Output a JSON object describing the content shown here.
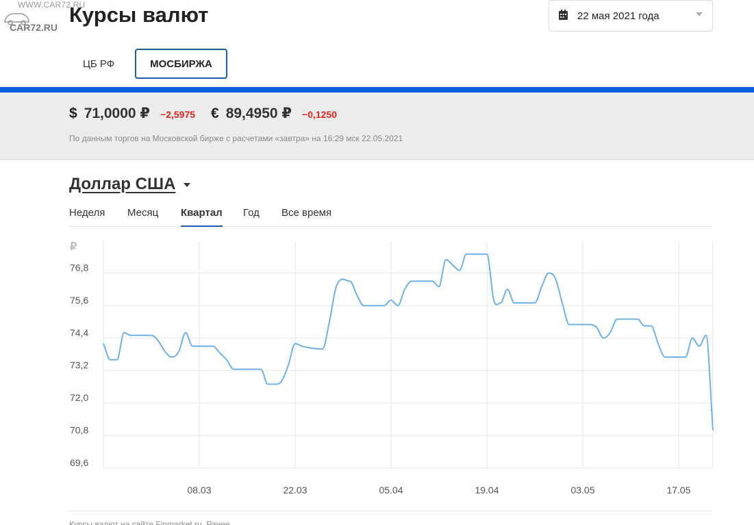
{
  "watermark": {
    "line1": "WWW.CAR72.RU",
    "line2": "CAR72.RU"
  },
  "header": {
    "title": "Курсы валют",
    "date_value": "22 мая 2021 года",
    "date_icon": "calendar-icon"
  },
  "source_tabs": [
    {
      "label": "ЦБ РФ",
      "active": false
    },
    {
      "label": "МОСБИРЖА",
      "active": true
    }
  ],
  "colors": {
    "accent_bar": "#0a5fe0",
    "negative_change": "#e0241b",
    "line": "#6fb1e6",
    "active_border": "#1a5aa8"
  },
  "rates": {
    "usd": {
      "symbol": "$",
      "value": "71,0000 ₽",
      "change": "−2,5975"
    },
    "eur": {
      "symbol": "€",
      "value": "89,4950 ₽",
      "change": "−0,1250"
    },
    "note": "По данным торгов на Московской бирже с расчетами «завтра» на 16:29 мск 22.05.2021"
  },
  "currency": {
    "name": "Доллар США"
  },
  "period_tabs": [
    {
      "label": "Неделя",
      "active": false
    },
    {
      "label": "Месяц",
      "active": false
    },
    {
      "label": "Квартал",
      "active": true
    },
    {
      "label": "Год",
      "active": false
    },
    {
      "label": "Все время",
      "active": false
    }
  ],
  "chart_data": {
    "type": "line",
    "ylabel": "₽",
    "ylim": [
      69.6,
      78.0
    ],
    "yticks": [
      "76,8",
      "75,6",
      "74,4",
      "73,2",
      "72,0",
      "70,8",
      "69,6"
    ],
    "ytick_values": [
      76.8,
      75.6,
      74.4,
      73.2,
      72.0,
      70.8,
      69.6
    ],
    "xlim": [
      "2021-02-22",
      "2021-05-22"
    ],
    "xticks": [
      {
        "label": "08.03",
        "date": "2021-03-08"
      },
      {
        "label": "22.03",
        "date": "2021-03-22"
      },
      {
        "label": "05.04",
        "date": "2021-04-05"
      },
      {
        "label": "19.04",
        "date": "2021-04-19"
      },
      {
        "label": "03.05",
        "date": "2021-05-03"
      },
      {
        "label": "17.05",
        "date": "2021-05-17"
      }
    ],
    "grid": true,
    "series": [
      {
        "points": [
          [
            "2021-02-22",
            74.2
          ],
          [
            "2021-02-23",
            73.6
          ],
          [
            "2021-02-24",
            73.6
          ],
          [
            "2021-02-25",
            74.6
          ],
          [
            "2021-02-26",
            74.5
          ],
          [
            "2021-03-01",
            74.5
          ],
          [
            "2021-03-02",
            74.3
          ],
          [
            "2021-03-03",
            73.9
          ],
          [
            "2021-03-04",
            73.7
          ],
          [
            "2021-03-05",
            73.9
          ],
          [
            "2021-03-06",
            74.6
          ],
          [
            "2021-03-07",
            74.1
          ],
          [
            "2021-03-10",
            74.1
          ],
          [
            "2021-03-11",
            73.85
          ],
          [
            "2021-03-12",
            73.6
          ],
          [
            "2021-03-13",
            73.25
          ],
          [
            "2021-03-14",
            73.25
          ],
          [
            "2021-03-17",
            73.25
          ],
          [
            "2021-03-18",
            72.7
          ],
          [
            "2021-03-19",
            72.7
          ],
          [
            "2021-03-20",
            72.8
          ],
          [
            "2021-03-21",
            73.4
          ],
          [
            "2021-03-22",
            74.2
          ],
          [
            "2021-03-23",
            74.1
          ],
          [
            "2021-03-26",
            74.0
          ],
          [
            "2021-03-27",
            75.0
          ],
          [
            "2021-03-28",
            76.3
          ],
          [
            "2021-03-30",
            76.5
          ],
          [
            "2021-03-31",
            76.0
          ],
          [
            "2021-04-01",
            75.6
          ],
          [
            "2021-04-04",
            75.6
          ],
          [
            "2021-04-05",
            75.8
          ],
          [
            "2021-04-06",
            75.6
          ],
          [
            "2021-04-07",
            76.2
          ],
          [
            "2021-04-08",
            76.5
          ],
          [
            "2021-04-11",
            76.5
          ],
          [
            "2021-04-12",
            76.3
          ],
          [
            "2021-04-13",
            77.3
          ],
          [
            "2021-04-14",
            77.1
          ],
          [
            "2021-04-15",
            76.9
          ],
          [
            "2021-04-16",
            77.5
          ],
          [
            "2021-04-19",
            77.5
          ],
          [
            "2021-04-20",
            75.8
          ],
          [
            "2021-04-21",
            75.7
          ],
          [
            "2021-04-22",
            76.2
          ],
          [
            "2021-04-23",
            75.7
          ],
          [
            "2021-04-26",
            75.7
          ],
          [
            "2021-04-27",
            76.3
          ],
          [
            "2021-04-28",
            76.8
          ],
          [
            "2021-04-29",
            76.6
          ],
          [
            "2021-04-30",
            75.7
          ],
          [
            "2021-05-01",
            74.9
          ],
          [
            "2021-05-04",
            74.9
          ],
          [
            "2021-05-05",
            74.8
          ],
          [
            "2021-05-06",
            74.4
          ],
          [
            "2021-05-07",
            74.6
          ],
          [
            "2021-05-08",
            75.1
          ],
          [
            "2021-05-11",
            75.1
          ],
          [
            "2021-05-12",
            74.85
          ],
          [
            "2021-05-13",
            74.85
          ],
          [
            "2021-05-14",
            74.2
          ],
          [
            "2021-05-15",
            73.7
          ],
          [
            "2021-05-18",
            73.7
          ],
          [
            "2021-05-19",
            74.4
          ],
          [
            "2021-05-20",
            74.1
          ],
          [
            "2021-05-21",
            74.5
          ],
          [
            "2021-05-22",
            71.0
          ]
        ]
      }
    ]
  },
  "footer": {
    "text": "Курсы валют на сайте Finmarket.ru. Ранее"
  }
}
